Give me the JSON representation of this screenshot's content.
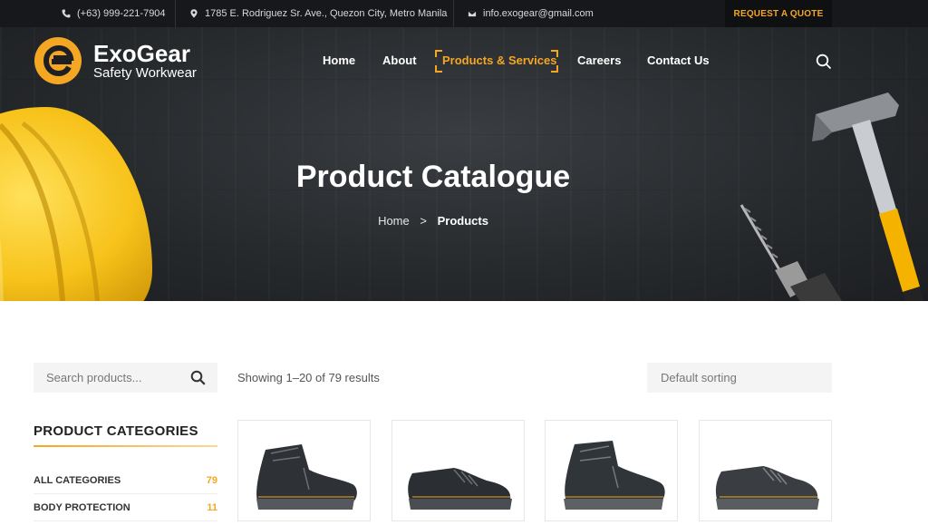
{
  "topbar": {
    "phone": "(+63) 999-221-7904",
    "address": "1785 E. Rodriguez Sr. Ave., Quezon City, Metro Manila",
    "email": "info.exogear@gmail.com",
    "quote_label": "REQUEST A QUOTE",
    "icons": [
      "phone-icon",
      "map-pin-icon",
      "envelope-icon"
    ]
  },
  "brand": {
    "name": "ExoGear",
    "tagline": "Safety Workwear",
    "accent": "#f5a623"
  },
  "nav": {
    "items": [
      {
        "label": "Home"
      },
      {
        "label": "About"
      },
      {
        "label": "Products & Services",
        "active": true
      },
      {
        "label": "Careers"
      },
      {
        "label": "Contact Us"
      }
    ]
  },
  "hero": {
    "title": "Product Catalogue",
    "breadcrumb": {
      "home": "Home",
      "separator": ">",
      "current": "Products"
    }
  },
  "shop": {
    "search_placeholder": "Search products...",
    "results_text": "Showing 1–20 of 79 results",
    "sorting_value": "Default sorting"
  },
  "sidebar": {
    "categories_title": "PRODUCT CATEGORIES",
    "categories": [
      {
        "label": "ALL CATEGORIES",
        "count": "79"
      },
      {
        "label": "BODY PROTECTION",
        "count": "11"
      }
    ]
  },
  "products": [
    {
      "image": "safety-boot-high-cut"
    },
    {
      "image": "safety-shoe-low-cut"
    },
    {
      "image": "safety-boot-high-cut"
    },
    {
      "image": "safety-shoe-low-cut"
    }
  ]
}
